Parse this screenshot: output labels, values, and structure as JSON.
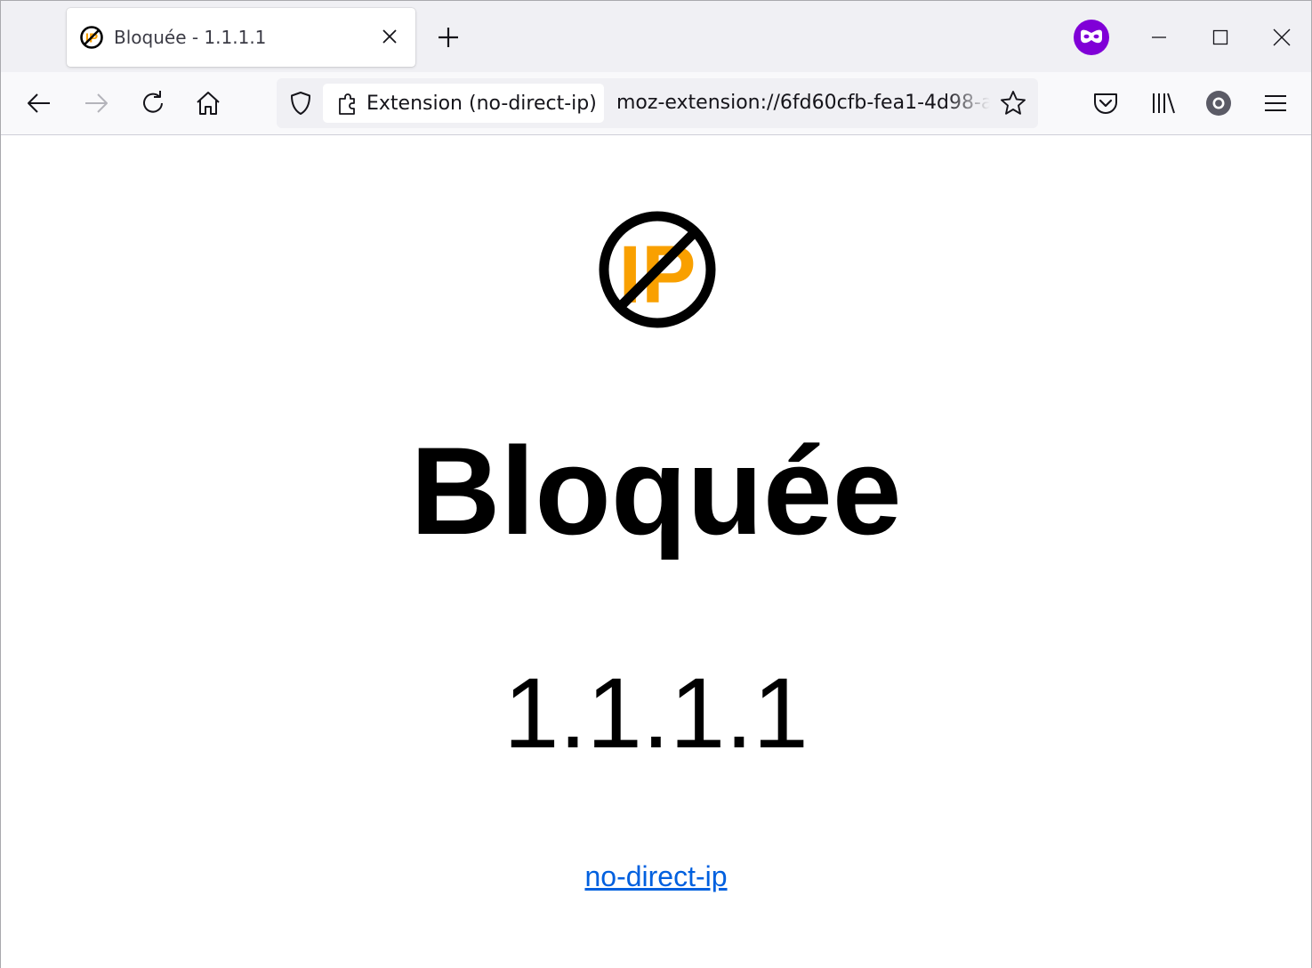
{
  "browser": {
    "tab": {
      "title": "Bloquée - 1.1.1.1",
      "favicon": "no-ip-icon"
    },
    "toolbar": {
      "identity_label": "Extension (no-direct-ip)",
      "url": "moz-extension://6fd60cfb-fea1-4d98-a"
    },
    "colors": {
      "private_badge": "#8000d7",
      "accent_orange": "#f9a000",
      "link": "#0060df"
    }
  },
  "page": {
    "heading": "Bloquée",
    "ip": "1.1.1.1",
    "link_text": "no-direct-ip"
  }
}
